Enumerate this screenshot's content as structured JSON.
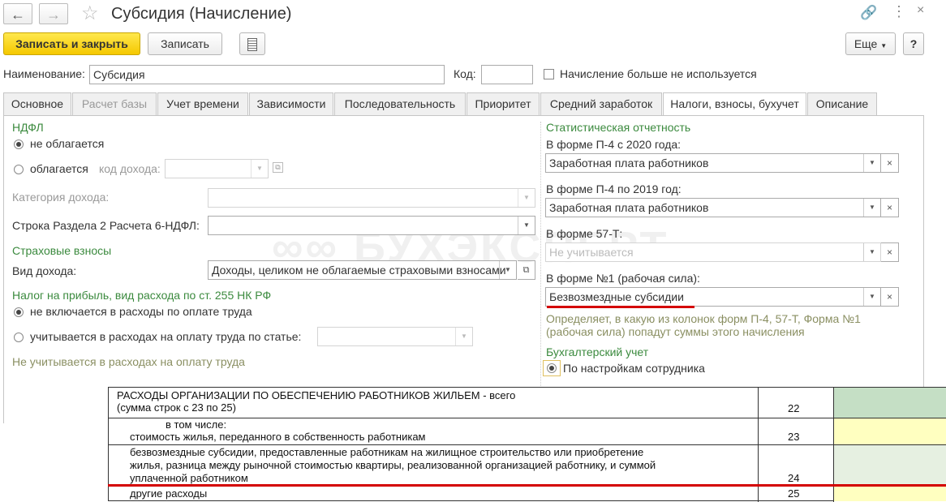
{
  "window": {
    "title": "Субсидия (Начисление)"
  },
  "toolbar": {
    "save_close": "Записать и закрыть",
    "save": "Записать",
    "more": "Еще",
    "help": "?"
  },
  "fields": {
    "name_label": "Наименование:",
    "name_value": "Субсидия",
    "code_label": "Код:",
    "code_value": "",
    "unused_label": "Начисление больше не используется"
  },
  "tabs": [
    "Основное",
    "Расчет базы",
    "Учет времени",
    "Зависимости",
    "Последовательность",
    "Приоритет",
    "Средний заработок",
    "Налоги, взносы, бухучет",
    "Описание"
  ],
  "left": {
    "ndfl_title": "НДФЛ",
    "radio_not_taxed": "не облагается",
    "radio_taxed": "облагается",
    "income_code_label": "код дохода:",
    "income_category_label": "Категория дохода:",
    "line6_label": "Строка Раздела 2 Расчета 6-НДФЛ:",
    "insurance_title": "Страховые взносы",
    "income_type_label": "Вид дохода:",
    "income_type_value": "Доходы, целиком не облагаемые страховыми взносами",
    "profit_title": "Налог на прибыль, вид расхода по ст. 255 НК РФ",
    "radio_not_included": "не включается в расходы по оплате труда",
    "radio_included": "учитывается в расходах на оплату труда по статье:",
    "profit_hint": "Не учитывается в расходах на оплату труда"
  },
  "right": {
    "stat_title": "Статистическая отчетность",
    "p4_2020_label": "В форме П-4 с 2020 года:",
    "p4_2020_value": "Заработная плата работников",
    "p4_2019_label": "В форме П-4 по 2019 год:",
    "p4_2019_value": "Заработная плата работников",
    "f57_label": "В форме 57-Т:",
    "f57_value": "Не учитывается",
    "f1_label": "В форме №1 (рабочая сила):",
    "f1_value": "Безвозмездные субсидии",
    "hint_line1": "Определяет, в какую из колонок форм П-4, 57-Т, Форма №1",
    "hint_line2": "(рабочая сила) попадут суммы этого начисления",
    "acc_title": "Бухгалтерский учет",
    "acc_radio": "По настройкам сотрудника"
  },
  "watermark": "БУХЭКСПЕРТ",
  "report": {
    "rows": [
      {
        "lines": [
          "РАСХОДЫ ОРГАНИЗАЦИИ ПО ОБЕСПЕЧЕНИЮ РАБОТНИКОВ ЖИЛЬЕМ - всего",
          "(сумма строк с 23 по 25)"
        ],
        "code": "22"
      },
      {
        "lines": [
          "в том числе:",
          "стоимость жилья, переданного в собственность работникам"
        ],
        "code": "23"
      },
      {
        "lines": [
          "безвозмездные субсидии, предоставленные работникам на жилищное строительство или приобретение",
          "жилья, разница между рыночной стоимостью квартиры, реализованной организацией работнику, и суммой",
          "уплаченной работником"
        ],
        "code": "24"
      },
      {
        "lines": [
          "другие расходы"
        ],
        "code": "25"
      }
    ]
  },
  "colors": {
    "green_label": "#3b8a3e",
    "highlight_red": "#d40000",
    "cell_green": "#c5dfc5",
    "cell_light_green": "#e6f0e1",
    "cell_yellow": "#ffffc0"
  }
}
